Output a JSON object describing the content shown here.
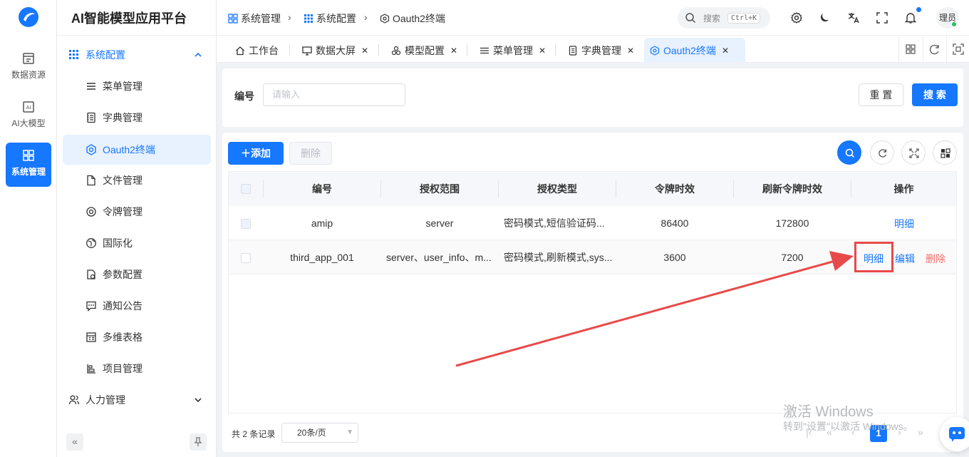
{
  "app": {
    "title": "AI智能模型应用平台"
  },
  "rail": [
    {
      "label": "数据资源",
      "icon": "database-icon"
    },
    {
      "label": "AI大模型",
      "icon": "ai-icon"
    },
    {
      "label": "系统管理",
      "icon": "system-icon",
      "active": true
    }
  ],
  "menu": {
    "group_label": "系统配置",
    "items": [
      {
        "label": "菜单管理",
        "icon": "menu-list-icon"
      },
      {
        "label": "字典管理",
        "icon": "dictionary-icon"
      },
      {
        "label": "Oauth2终端",
        "icon": "oauth-icon",
        "active": true
      },
      {
        "label": "文件管理",
        "icon": "file-icon"
      },
      {
        "label": "令牌管理",
        "icon": "token-icon"
      },
      {
        "label": "国际化",
        "icon": "globe-icon"
      },
      {
        "label": "参数配置",
        "icon": "params-icon"
      },
      {
        "label": "通知公告",
        "icon": "notice-icon"
      },
      {
        "label": "多维表格",
        "icon": "table-icon"
      },
      {
        "label": "项目管理",
        "icon": "project-icon"
      }
    ],
    "hr_label": "人力管理"
  },
  "breadcrumb": [
    "系统管理",
    "系统配置",
    "Oauth2终端"
  ],
  "header": {
    "search_placeholder": "搜索",
    "shortcut": "Ctrl+K",
    "user": "理员"
  },
  "tabs": [
    {
      "label": "工作台",
      "icon": "home-icon"
    },
    {
      "label": "数据大屏",
      "icon": "monitor-icon"
    },
    {
      "label": "模型配置",
      "icon": "model-icon"
    },
    {
      "label": "菜单管理",
      "icon": "menu-list-icon"
    },
    {
      "label": "字典管理",
      "icon": "dictionary-icon"
    },
    {
      "label": "Oauth2终端",
      "icon": "oauth-icon",
      "active": true
    }
  ],
  "filter": {
    "label": "编号",
    "placeholder": "请输入",
    "reset": "重 置",
    "search": "搜 索"
  },
  "toolbar": {
    "add": "添加",
    "delete": "删除"
  },
  "table": {
    "columns": [
      "编号",
      "授权范围",
      "授权类型",
      "令牌时效",
      "刷新令牌时效",
      "操作"
    ],
    "rows": [
      {
        "id": "amip",
        "scope": "server",
        "grant": "密码模式,短信验证码...",
        "token": "86400",
        "refresh": "172800",
        "actions": [
          "明细"
        ]
      },
      {
        "id": "third_app_001",
        "scope": "server、user_info、m...",
        "grant": "密码模式,刷新模式,sys...",
        "token": "3600",
        "refresh": "7200",
        "actions": [
          "明细",
          "编辑",
          "删除"
        ]
      }
    ]
  },
  "pagination": {
    "total_text": "共 2 条记录",
    "page_size": "20条/页",
    "current": "1"
  },
  "watermark": {
    "line1": "激活 Windows",
    "line2": "转到\"设置\"以激活 Windows。"
  },
  "colors": {
    "primary": "#1677ff",
    "danger": "#f56c6c",
    "annotation": "#e84a4a"
  }
}
